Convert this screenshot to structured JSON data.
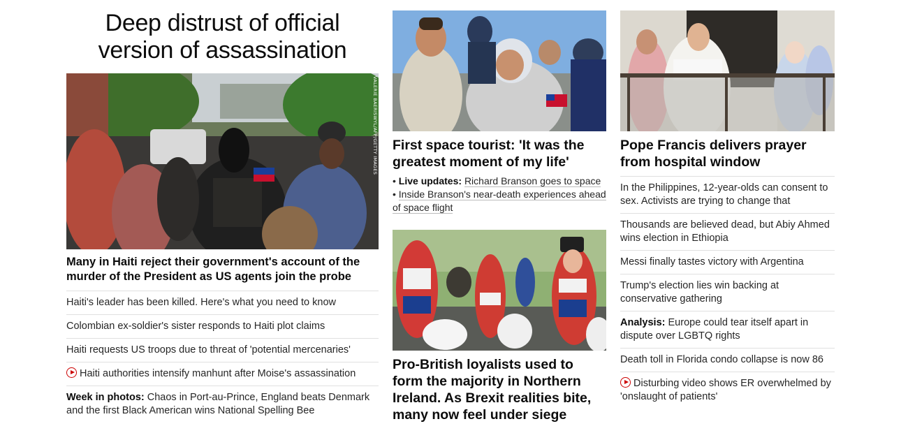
{
  "col1": {
    "title": "Deep distrust of official version of assassination",
    "photo_credit": "VALERIE BAERISWYL/AFP/GETTY IMAGES",
    "lead_headline": "Many in Haiti reject their government's account of the murder of the President as US agents join the probe",
    "items": [
      {
        "text": "Haiti's leader has been killed. Here's what you need to know"
      },
      {
        "text": "Colombian ex-soldier's sister responds to Haiti plot claims"
      },
      {
        "text": "Haiti requests US troops due to threat of 'potential mercenaries'"
      },
      {
        "text": "Haiti authorities intensify manhunt after Moise's assassination",
        "video": true
      },
      {
        "bold": "Week in photos:",
        "text": " Chaos in Port-au-Prince, England beats Denmark and the first Black American wins National Spelling Bee"
      }
    ]
  },
  "col2": {
    "story1": {
      "headline": "First space tourist: 'It was the greatest moment of my life'",
      "bullets": [
        {
          "bold": "Live updates:",
          "text": "Richard Branson goes to space"
        },
        {
          "text": "Inside Branson's near-death experiences ahead of space flight"
        }
      ]
    },
    "story2": {
      "headline": "Pro-British loyalists used to form the majority in Northern Ireland. As Brexit realities bite, many now feel under siege"
    }
  },
  "col3": {
    "headline": "Pope Francis delivers prayer from hospital window",
    "items": [
      {
        "text": "In the Philippines, 12-year-olds can consent to sex. Activists are trying to change that"
      },
      {
        "text": "Thousands are believed dead, but Abiy Ahmed wins election in Ethiopia"
      },
      {
        "text": "Messi finally tastes victory with Argentina"
      },
      {
        "text": "Trump's election lies win backing at conservative gathering"
      },
      {
        "bold": "Analysis:",
        "text": " Europe could tear itself apart in dispute over LGBTQ rights"
      },
      {
        "text": "Death toll in Florida condo collapse is now 86"
      },
      {
        "text": "Disturbing video shows ER overwhelmed by 'onslaught of patients'",
        "video": true
      }
    ]
  }
}
